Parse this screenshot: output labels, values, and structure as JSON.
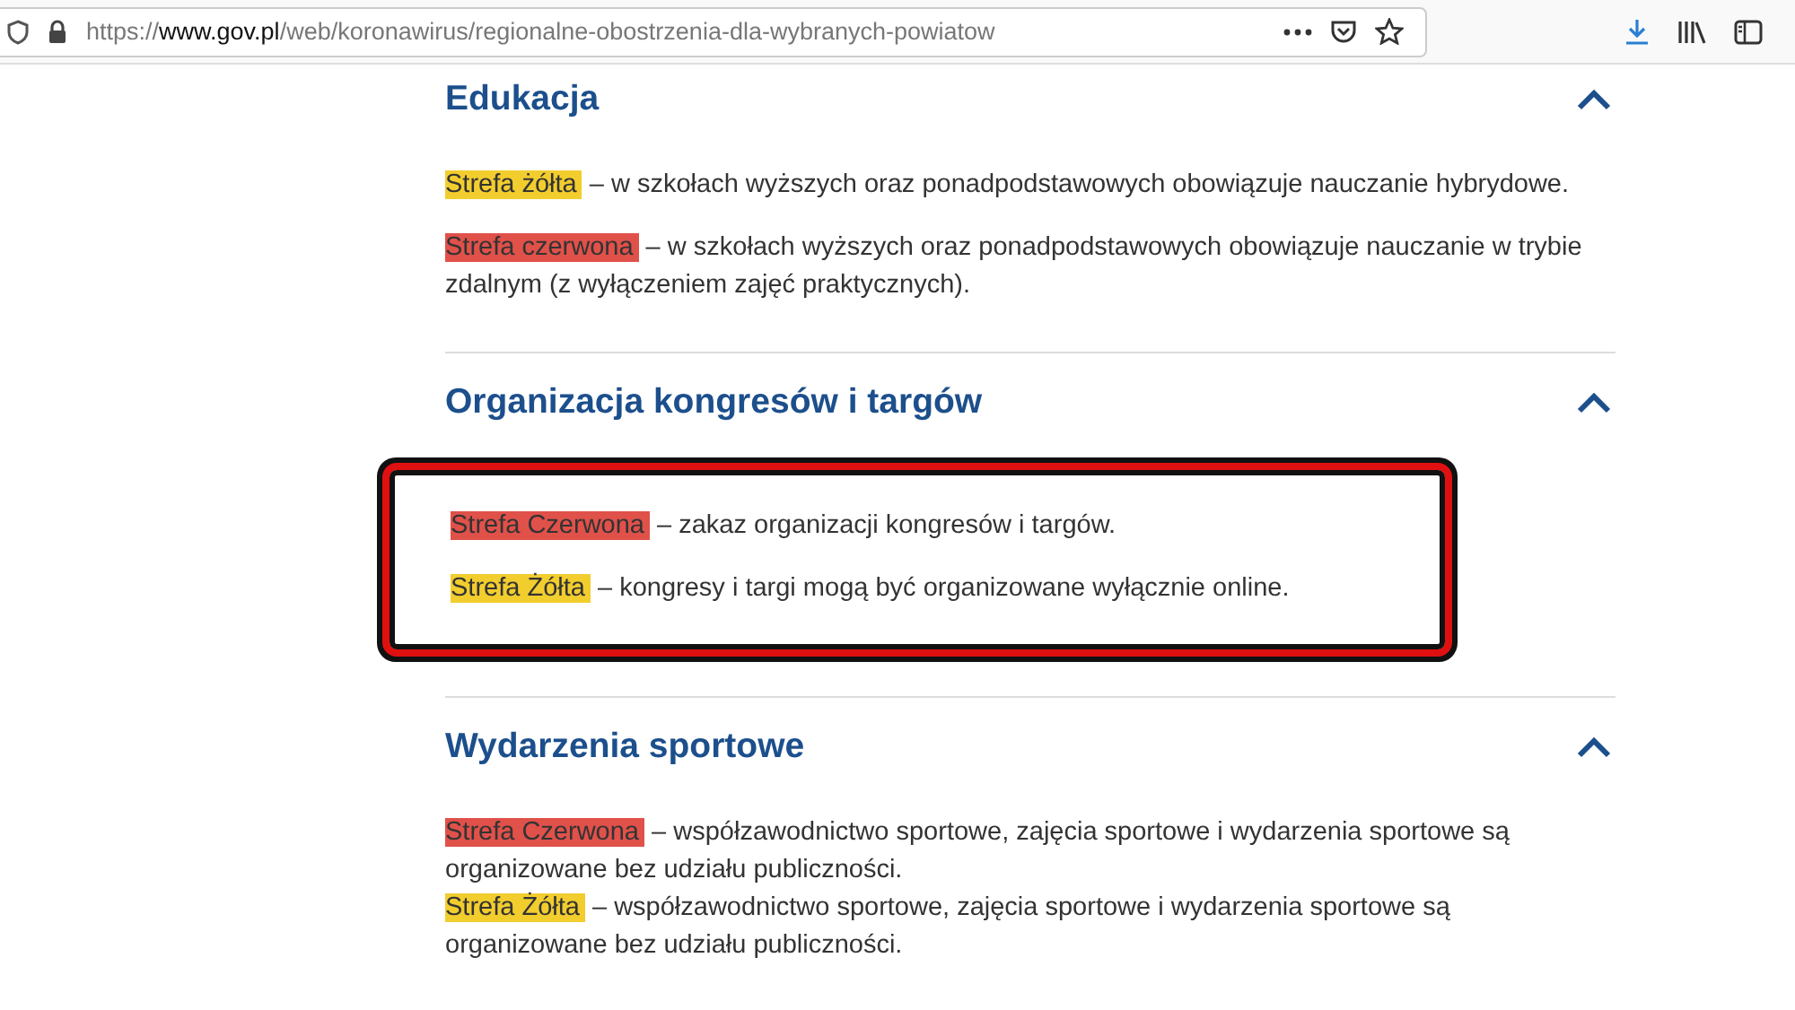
{
  "browser": {
    "url": "https://**www.gov.pl**/web/koronawirus/regionalne-obostrzenia-dla-wybranych-powiatow"
  },
  "sections": [
    {
      "title": "Edukacja",
      "expanded": true,
      "framed": false,
      "compact": false,
      "rules": [
        {
          "zone": "Strefa żółta",
          "color": "#f2cd2e",
          "text": " – w szkołach wyższych oraz ponadpodstawowych obowiązuje nauczanie hybrydowe."
        },
        {
          "zone": "Strefa czerwona",
          "color": "#e0514a",
          "text": " – w szkołach wyższych oraz ponadpodstawowych obowiązuje nauczanie w trybie zdalnym (z wyłączeniem zajęć praktycznych)."
        }
      ]
    },
    {
      "title": "Organizacja kongresów i targów",
      "expanded": true,
      "framed": true,
      "compact": false,
      "rules": [
        {
          "zone": "Strefa Czerwona",
          "color": "#e0514a",
          "text": " – zakaz organizacji kongresów i targów."
        },
        {
          "zone": "Strefa Żółta",
          "color": "#f2cd2e",
          "text": " – kongresy i targi mogą być organizowane wyłącznie online."
        }
      ]
    },
    {
      "title": "Wydarzenia sportowe",
      "expanded": true,
      "framed": false,
      "compact": true,
      "rules": [
        {
          "zone": "Strefa Czerwona",
          "color": "#e0514a",
          "text": " – współzawodnictwo sportowe, zajęcia sportowe i wydarzenia sportowe są organizowane bez udziału publiczności."
        },
        {
          "zone": "Strefa Żółta",
          "color": "#f2cd2e",
          "text": " – współzawodnictwo sportowe, zajęcia sportowe i wydarzenia sportowe są organizowane bez udziału publiczności."
        }
      ]
    }
  ]
}
